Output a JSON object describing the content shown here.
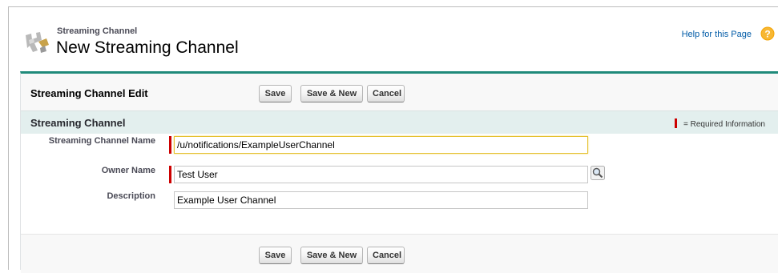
{
  "header": {
    "subtitle": "Streaming Channel",
    "title": "New Streaming Channel",
    "help_link": "Help for this Page",
    "icon": "streaming-channel-icon"
  },
  "panel": {
    "title": "Streaming Channel Edit",
    "buttons": {
      "save": "Save",
      "save_new": "Save & New",
      "cancel": "Cancel"
    },
    "accent_color": "#1f8a7a"
  },
  "section": {
    "title": "Streaming Channel",
    "required_legend": "= Required Information",
    "required_color": "#cc0000"
  },
  "fields": {
    "name": {
      "label": "Streaming Channel Name",
      "value": "/u/notifications/ExampleUserChannel",
      "required": true
    },
    "owner": {
      "label": "Owner Name",
      "value": "Test User",
      "required": true
    },
    "description": {
      "label": "Description",
      "value": "Example User Channel",
      "required": false
    }
  },
  "footer_buttons": {
    "save": "Save",
    "save_new": "Save & New",
    "cancel": "Cancel"
  }
}
